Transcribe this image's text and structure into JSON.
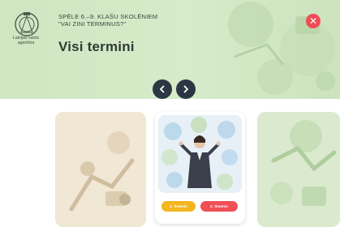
{
  "agency": {
    "name": "Latvijas valsts agentūra"
  },
  "header": {
    "game_subtitle_line1": "SPĒLE 6.–9. KLAŠU SKOLĒNIEM",
    "game_subtitle_line2": "\"VAI ZINI TERMINUS?\"",
    "title": "Visi termini"
  },
  "controls": {
    "close_symbol": "✕",
    "prev_symbol": "‹",
    "next_symbol": "›"
  },
  "cards": {
    "center": {
      "level_1_label": "1. līmenis",
      "level_2_label": "2. līmenis"
    }
  },
  "colors": {
    "hero_bg": "#d6ebc9",
    "nav_button": "#2c3744",
    "close_button": "#f14d57",
    "level_1": "#f3b61f",
    "level_2": "#ef4f55"
  }
}
